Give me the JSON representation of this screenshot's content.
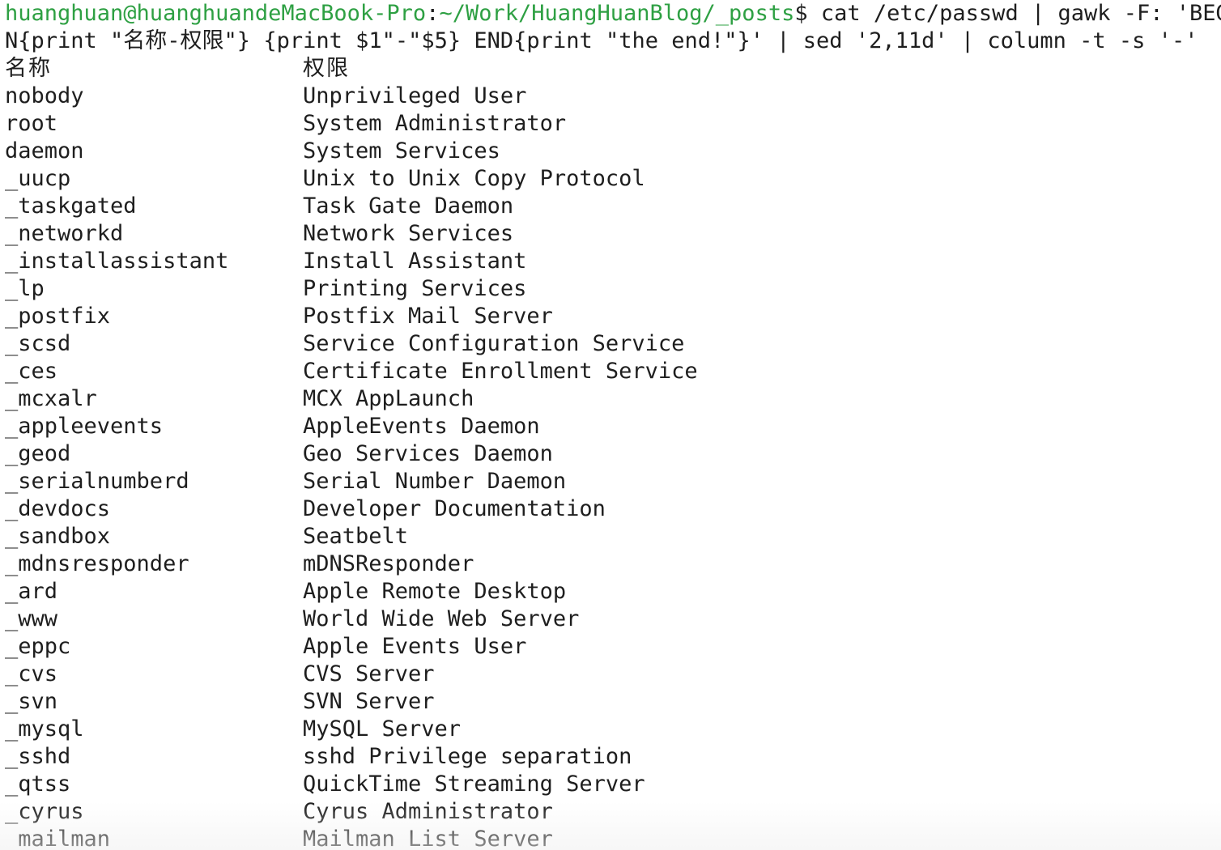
{
  "terminal": {
    "prompt": {
      "user_host": "huanghuan@huanghuandeMacBook-Pro",
      "separator": ":",
      "path": "~/Work/HuangHuanBlog/_posts",
      "symbol": "$"
    },
    "command_line1": " cat /etc/passwd | gawk -F: 'BEGI",
    "command_line2": "N{print \"名称-权限\"} {print $1\"-\"$5} END{print \"the end!\"}' | sed '2,11d' | column -t -s '-'",
    "header": {
      "name": "名称",
      "permission": "权限"
    },
    "rows": [
      {
        "name": "nobody",
        "permission": "Unprivileged User"
      },
      {
        "name": "root",
        "permission": "System Administrator"
      },
      {
        "name": "daemon",
        "permission": "System Services"
      },
      {
        "name": "_uucp",
        "permission": "Unix to Unix Copy Protocol"
      },
      {
        "name": "_taskgated",
        "permission": "Task Gate Daemon"
      },
      {
        "name": "_networkd",
        "permission": "Network Services"
      },
      {
        "name": "_installassistant",
        "permission": "Install Assistant"
      },
      {
        "name": "_lp",
        "permission": "Printing Services"
      },
      {
        "name": "_postfix",
        "permission": "Postfix Mail Server"
      },
      {
        "name": "_scsd",
        "permission": "Service Configuration Service"
      },
      {
        "name": "_ces",
        "permission": "Certificate Enrollment Service"
      },
      {
        "name": "_mcxalr",
        "permission": "MCX AppLaunch"
      },
      {
        "name": "_appleevents",
        "permission": "AppleEvents Daemon"
      },
      {
        "name": "_geod",
        "permission": "Geo Services Daemon"
      },
      {
        "name": "_serialnumberd",
        "permission": "Serial Number Daemon"
      },
      {
        "name": "_devdocs",
        "permission": "Developer Documentation"
      },
      {
        "name": "_sandbox",
        "permission": "Seatbelt"
      },
      {
        "name": "_mdnsresponder",
        "permission": "mDNSResponder"
      },
      {
        "name": "_ard",
        "permission": "Apple Remote Desktop"
      },
      {
        "name": "_www",
        "permission": "World Wide Web Server"
      },
      {
        "name": "_eppc",
        "permission": "Apple Events User"
      },
      {
        "name": "_cvs",
        "permission": "CVS Server"
      },
      {
        "name": "_svn",
        "permission": "SVN Server"
      },
      {
        "name": "_mysql",
        "permission": "MySQL Server"
      },
      {
        "name": "_sshd",
        "permission": "sshd Privilege separation"
      },
      {
        "name": "_qtss",
        "permission": "QuickTime Streaming Server"
      },
      {
        "name": "_cyrus",
        "permission": "Cyrus Administrator"
      },
      {
        "name": "_mailman",
        "permission": "Mailman List Server"
      }
    ],
    "colors": {
      "prompt": "#2ea043",
      "text": "#1e1e1e",
      "background": "#ffffff"
    }
  }
}
